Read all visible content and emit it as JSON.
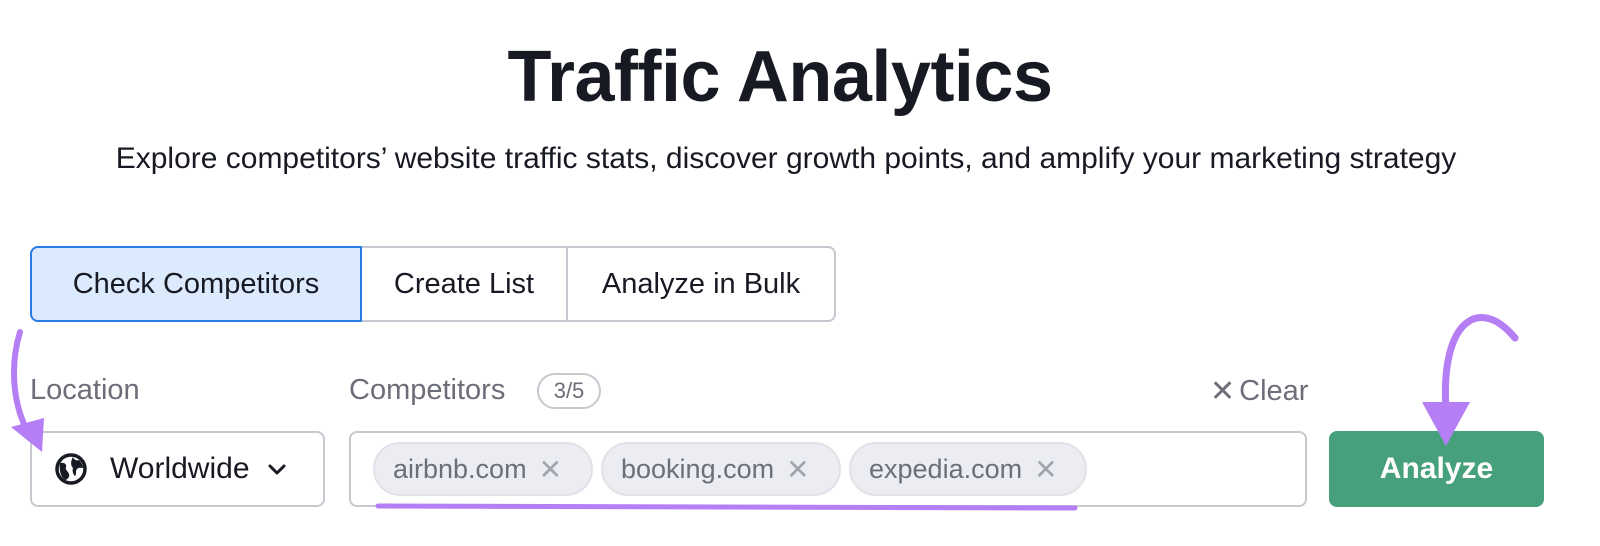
{
  "header": {
    "title": "Traffic Analytics",
    "subtitle": "Explore competitors’ website traffic stats, discover growth points, and amplify your marketing strategy"
  },
  "tabs": [
    {
      "label": "Check Competitors",
      "active": true
    },
    {
      "label": "Create List",
      "active": false
    },
    {
      "label": "Analyze in Bulk",
      "active": false
    }
  ],
  "location": {
    "label": "Location",
    "value": "Worldwide",
    "icon": "globe-icon"
  },
  "competitors": {
    "label": "Competitors",
    "count": "3/5",
    "clear_label": "Clear",
    "chips": [
      "airbnb.com",
      "booking.com",
      "expedia.com"
    ]
  },
  "analyze_label": "Analyze",
  "colors": {
    "accent_green": "#47a07c",
    "active_tab_bg": "#dbeafc",
    "active_tab_border": "#2c7be5",
    "annotation_purple": "#b57ef5"
  }
}
